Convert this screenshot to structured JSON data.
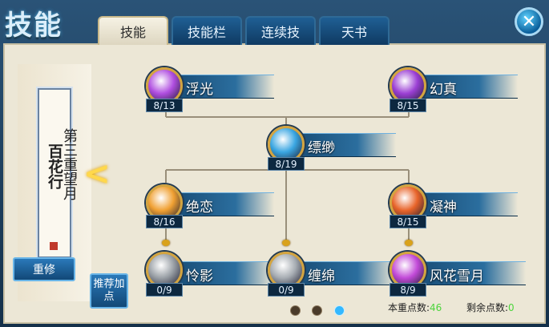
{
  "header": {
    "title": "技能",
    "tabs": [
      {
        "label": "技能",
        "active": true
      },
      {
        "label": "技能栏",
        "active": false
      },
      {
        "label": "连续技",
        "active": false
      },
      {
        "label": "天书",
        "active": false
      }
    ],
    "close_icon": "close-icon"
  },
  "sect": {
    "name": "百花行",
    "chapter": "第三重望月",
    "nav_icon": "chevron-left-icon",
    "reset_label": "重修"
  },
  "recommend_label": "推荐加点",
  "skills": [
    {
      "name": "浮光",
      "level": "8/13",
      "orb_color": "#b04ee0"
    },
    {
      "name": "幻真",
      "level": "8/15",
      "orb_color": "#9b3fd4"
    },
    {
      "name": "缥缈",
      "level": "8/19",
      "orb_color": "#3aa6e2"
    },
    {
      "name": "绝恋",
      "level": "8/16",
      "orb_color": "#f0a032"
    },
    {
      "name": "凝神",
      "level": "8/15",
      "orb_color": "#e8642a"
    },
    {
      "name": "怜影",
      "level": "0/9",
      "orb_color": "#9aa0a6"
    },
    {
      "name": "缠绵",
      "level": "0/9",
      "orb_color": "#a7adb3"
    },
    {
      "name": "风花雪月",
      "level": "8/9",
      "orb_color": "#c24ad8"
    }
  ],
  "pages": {
    "count": 3,
    "active": 2
  },
  "points": {
    "current_label": "本重点数:",
    "current_value": "46",
    "remaining_label": "剩余点数:",
    "remaining_value": "0"
  },
  "colors": {
    "accent": "#2b6e9e",
    "points_value": "#4bd43b",
    "locked_gold": "#d9a21b"
  }
}
